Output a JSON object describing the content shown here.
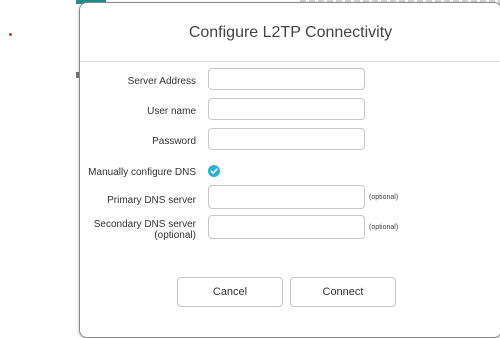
{
  "dialog": {
    "title": "Configure L2TP Connectivity",
    "fields": {
      "server_address": {
        "label": "Server Address",
        "value": ""
      },
      "user_name": {
        "label": "User name",
        "value": ""
      },
      "password": {
        "label": "Password",
        "value": ""
      },
      "manual_dns": {
        "label": "Manually configure DNS",
        "checked": true
      },
      "primary_dns": {
        "label": "Primary DNS server",
        "value": "",
        "hint": "(optional)"
      },
      "secondary_dns": {
        "label_line1": "Secondary DNS server",
        "label_line2": "(optional)",
        "value": "",
        "hint": "(optional)"
      }
    },
    "buttons": {
      "cancel": "Cancel",
      "connect": "Connect"
    }
  },
  "colors": {
    "checkbox_accent": "#2bb0d8",
    "background_accent": "#2a8a8a",
    "marker_red": "#d33a2c"
  }
}
